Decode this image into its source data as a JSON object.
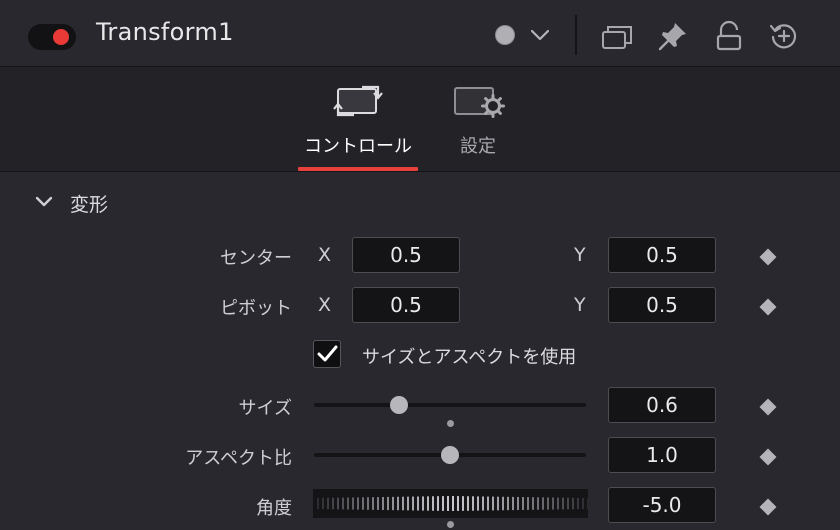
{
  "header": {
    "title": "Transform1",
    "toggle_color": "#ea3a37",
    "icons": [
      "color-dot-icon",
      "chevron-down-icon",
      "versions-icon",
      "pin-icon",
      "lock-icon",
      "reset-icon"
    ]
  },
  "tabs": [
    {
      "label": "コントロール",
      "icon": "transform-icon",
      "active": true
    },
    {
      "label": "設定",
      "icon": "settings-icon",
      "active": false
    }
  ],
  "accent_color": "#e6413d",
  "section": {
    "title": "変形",
    "expanded": true
  },
  "controls": {
    "center": {
      "label": "センター",
      "x_label": "X",
      "x": "0.5",
      "y_label": "Y",
      "y": "0.5"
    },
    "pivot": {
      "label": "ピボット",
      "x_label": "X",
      "x": "0.5",
      "y_label": "Y",
      "y": "0.5"
    },
    "use_size_and_aspect": {
      "label": "サイズとアスペクトを使用",
      "checked": true
    },
    "size": {
      "label": "サイズ",
      "value": "0.6"
    },
    "aspect": {
      "label": "アスペクト比",
      "value": "1.0"
    },
    "angle": {
      "label": "角度",
      "value": "-5.0"
    }
  }
}
